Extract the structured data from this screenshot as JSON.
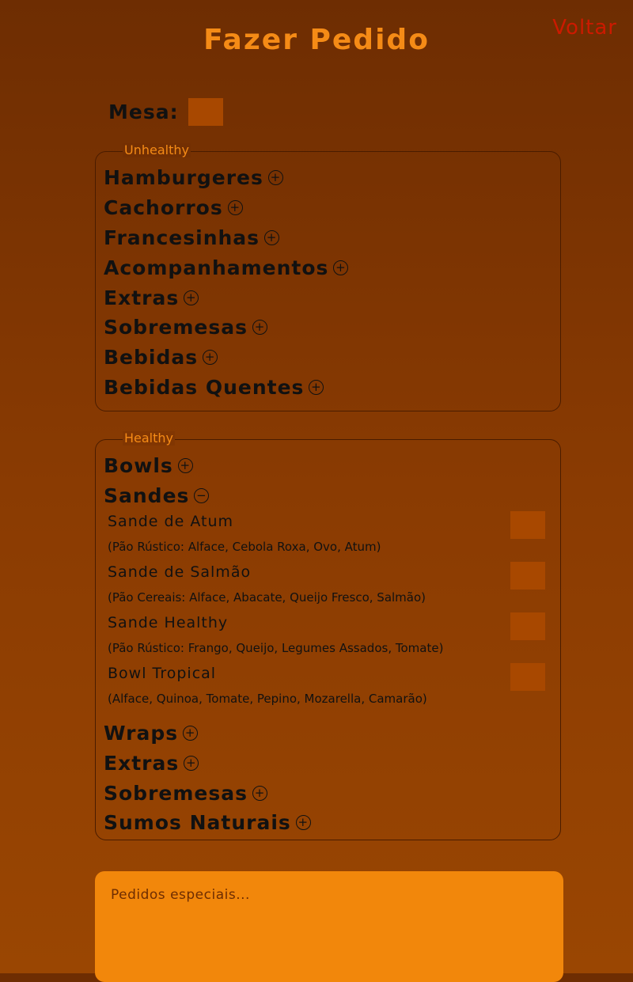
{
  "page": {
    "title": "Fazer Pedido",
    "back_link": "Voltar"
  },
  "table": {
    "label": "Mesa:",
    "value": ""
  },
  "unhealthy": {
    "legend": "Unhealthy",
    "categories": [
      {
        "label": "Hamburgeres",
        "toggle": "+"
      },
      {
        "label": "Cachorros",
        "toggle": "+"
      },
      {
        "label": "Francesinhas",
        "toggle": "+"
      },
      {
        "label": "Acompanhamentos",
        "toggle": "+"
      },
      {
        "label": "Extras",
        "toggle": "+"
      },
      {
        "label": "Sobremesas",
        "toggle": "+"
      },
      {
        "label": "Bebidas",
        "toggle": "+"
      },
      {
        "label": "Bebidas Quentes",
        "toggle": "+"
      }
    ]
  },
  "healthy": {
    "legend": "Healthy",
    "categories_before": [
      {
        "label": "Bowls",
        "toggle": "+"
      },
      {
        "label": "Sandes",
        "toggle": "−"
      }
    ],
    "sandes_items": [
      {
        "name": "Sande de Atum",
        "description": "(Pão Rústico: Alface, Cebola Roxa, Ovo, Atum)",
        "quantity": ""
      },
      {
        "name": "Sande de Salmão",
        "description": "(Pão Cereais: Alface, Abacate, Queijo Fresco, Salmão)",
        "quantity": ""
      },
      {
        "name": "Sande Healthy",
        "description": "(Pão Rústico: Frango, Queijo, Legumes Assados, Tomate)",
        "quantity": ""
      },
      {
        "name": "Bowl Tropical",
        "description": "(Alface, Quinoa, Tomate, Pepino, Mozarella, Camarão)",
        "quantity": ""
      }
    ],
    "categories_after": [
      {
        "label": "Wraps",
        "toggle": "+"
      },
      {
        "label": "Extras",
        "toggle": "+"
      },
      {
        "label": "Sobremesas",
        "toggle": "+"
      },
      {
        "label": "Sumos Naturais",
        "toggle": "+"
      }
    ]
  },
  "special_requests": {
    "placeholder": "Pedidos especiais..."
  },
  "colors": {
    "title": "#f58b16",
    "back_link": "#cc1a00",
    "input_bg": "#a84800",
    "textarea_bg": "#f2870b"
  }
}
